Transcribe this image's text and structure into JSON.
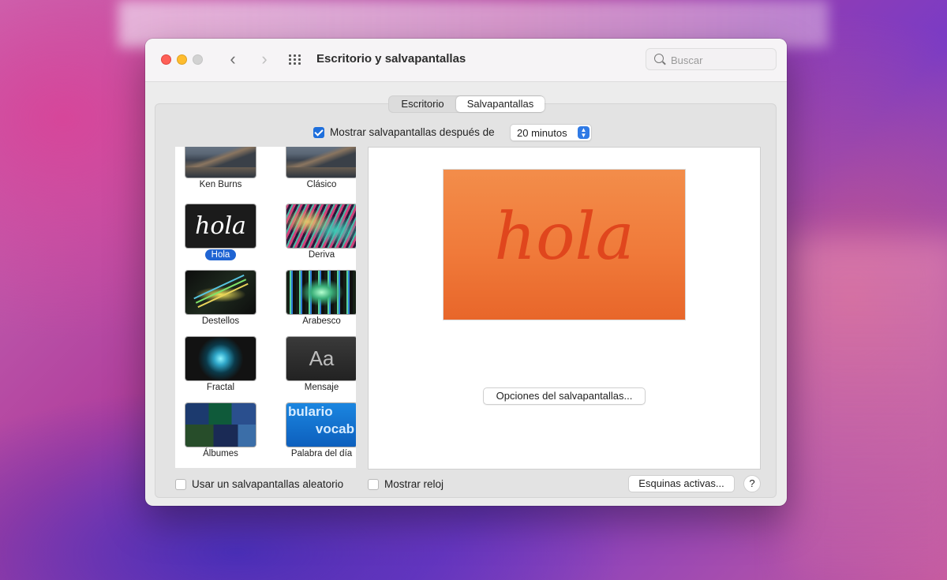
{
  "window": {
    "title": "Escritorio y salvapantallas"
  },
  "search": {
    "placeholder": "Buscar"
  },
  "tabs": [
    {
      "label": "Escritorio"
    },
    {
      "label": "Salvapantallas"
    }
  ],
  "show_after": {
    "label": "Mostrar salvapantallas después de",
    "checked": true,
    "value": "20 minutos"
  },
  "screensavers": [
    {
      "label": "Ken Burns",
      "icon": "mountain-thumbnail"
    },
    {
      "label": "Clásico",
      "icon": "mountain-thumbnail"
    },
    {
      "label": "Hola",
      "icon": "hola-thumbnail",
      "thumb_text": "hola",
      "selected": true
    },
    {
      "label": "Deriva",
      "icon": "drift-thumbnail"
    },
    {
      "label": "Destellos",
      "icon": "flurry-thumbnail"
    },
    {
      "label": "Arabesco",
      "icon": "arabesque-thumbnail"
    },
    {
      "label": "Fractal",
      "icon": "fractal-thumbnail"
    },
    {
      "label": "Mensaje",
      "icon": "message-thumbnail",
      "thumb_text": "Aa"
    },
    {
      "label": "Álbumes",
      "icon": "albums-thumbnail"
    },
    {
      "label": "Palabra del día",
      "icon": "word-of-day-thumbnail",
      "thumb_text_1": "bulario",
      "thumb_text_2": "vocab"
    }
  ],
  "preview": {
    "text": "hola",
    "color": "#f07a3a"
  },
  "options_button": "Opciones del salvapantallas...",
  "random_checkbox": {
    "label": "Usar un salvapantallas aleatorio",
    "checked": false
  },
  "clock_checkbox": {
    "label": "Mostrar reloj",
    "checked": false
  },
  "hot_corners_button": "Esquinas activas...",
  "help_button": "?",
  "colors": {
    "accent": "#1e6fdc",
    "selection": "#1f64d3"
  }
}
